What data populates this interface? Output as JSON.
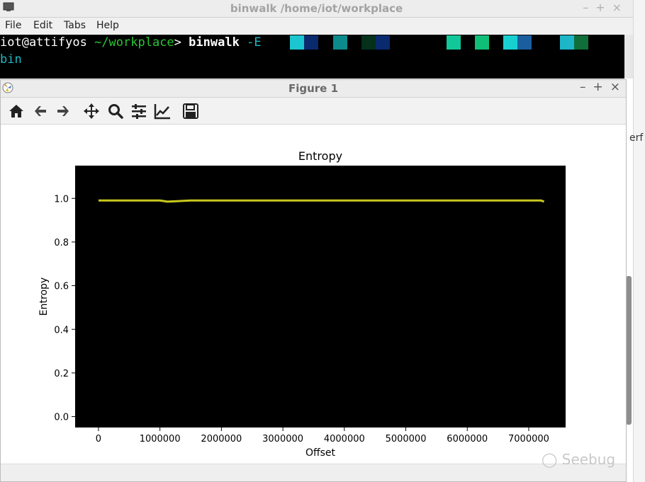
{
  "terminal": {
    "title": "binwalk  /home/iot/workplace",
    "menu": [
      "File",
      "Edit",
      "Tabs",
      "Help"
    ],
    "prompt_user": "iot@attifyos",
    "prompt_path": "~/workplace",
    "prompt_symbol": ">",
    "command": "binwalk",
    "flag": "-E",
    "wrap_text": "bin"
  },
  "side_text": "erf",
  "figure": {
    "title": "Figure 1",
    "toolbar": [
      "home-icon",
      "back-icon",
      "forward-icon",
      "pan-icon",
      "zoom-icon",
      "configure-subplots-icon",
      "edit-axis-icon",
      "save-icon"
    ]
  },
  "watermark": "Seebug",
  "chart_data": {
    "type": "line",
    "title": "Entropy",
    "xlabel": "Offset",
    "ylabel": "Entropy",
    "xlim": [
      -380000,
      7600000
    ],
    "ylim": [
      -0.05,
      1.15
    ],
    "xticks": [
      0,
      1000000,
      2000000,
      3000000,
      4000000,
      5000000,
      6000000,
      7000000
    ],
    "yticks": [
      0.0,
      0.2,
      0.4,
      0.6,
      0.8,
      1.0
    ],
    "ytick_labels": [
      "0.0",
      "0.2",
      "0.4",
      "0.6",
      "0.8",
      "1.0"
    ],
    "background": "#000000",
    "grid": false,
    "series": [
      {
        "color": "#c8c81e",
        "x": [
          0,
          500000,
          1000000,
          1120000,
          1500000,
          2000000,
          2500000,
          3000000,
          3500000,
          4000000,
          4500000,
          5000000,
          5500000,
          6000000,
          6500000,
          7000000,
          7200000,
          7250000
        ],
        "y": [
          0.99,
          0.99,
          0.99,
          0.985,
          0.99,
          0.99,
          0.99,
          0.99,
          0.99,
          0.99,
          0.99,
          0.99,
          0.99,
          0.99,
          0.99,
          0.99,
          0.99,
          0.985
        ]
      }
    ]
  }
}
